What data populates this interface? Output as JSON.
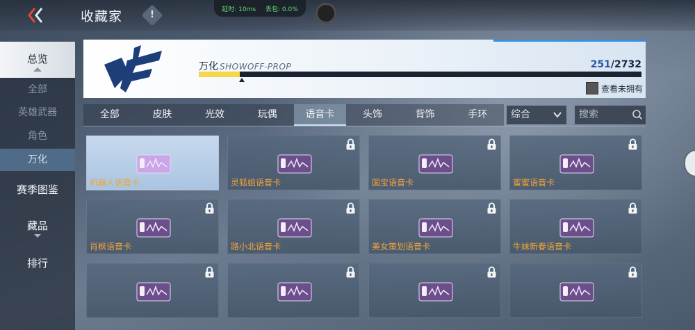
{
  "header": {
    "title": "收藏家",
    "info_icon": "!"
  },
  "network": {
    "latency": "延时: 10ms",
    "packet_loss": "丢包: 0.0%"
  },
  "sidebar": {
    "overview": "总览",
    "sub_all": "全部",
    "sub_weapons": "英雄武器",
    "sub_roles": "角色",
    "sub_variety": "万化",
    "season": "赛季图鉴",
    "collection": "藏品",
    "ranking": "排行"
  },
  "banner": {
    "name": "万化",
    "sub": "SHOWOFF-PROP",
    "count_current": "251",
    "count_total": "/2732",
    "progress": 0.092,
    "show_unowned": "查看未拥有"
  },
  "tabs": [
    "全部",
    "皮肤",
    "光效",
    "玩偶",
    "语音卡",
    "头饰",
    "背饰",
    "手环"
  ],
  "active_tab": 4,
  "sort": {
    "value": "综合"
  },
  "search": {
    "placeholder": "搜索"
  },
  "cards": [
    {
      "name": "机器人语音卡",
      "owned": true
    },
    {
      "name": "灵狐姐语音卡",
      "owned": false
    },
    {
      "name": "国宝语音卡",
      "owned": false
    },
    {
      "name": "蜜蜜语音卡",
      "owned": false
    },
    {
      "name": "肖枫语音卡",
      "owned": false
    },
    {
      "name": "路小北语音卡",
      "owned": false
    },
    {
      "name": "美女策划语音卡",
      "owned": false
    },
    {
      "name": "牛妹新春语音卡",
      "owned": false
    },
    {
      "name": "",
      "owned": false
    },
    {
      "name": "",
      "owned": false
    },
    {
      "name": "",
      "owned": false
    },
    {
      "name": "",
      "owned": false
    }
  ],
  "colors": {
    "accent_yellow": "#f6d64a",
    "card_name": "#f0a534",
    "banner_blue": "#2a58a8"
  }
}
